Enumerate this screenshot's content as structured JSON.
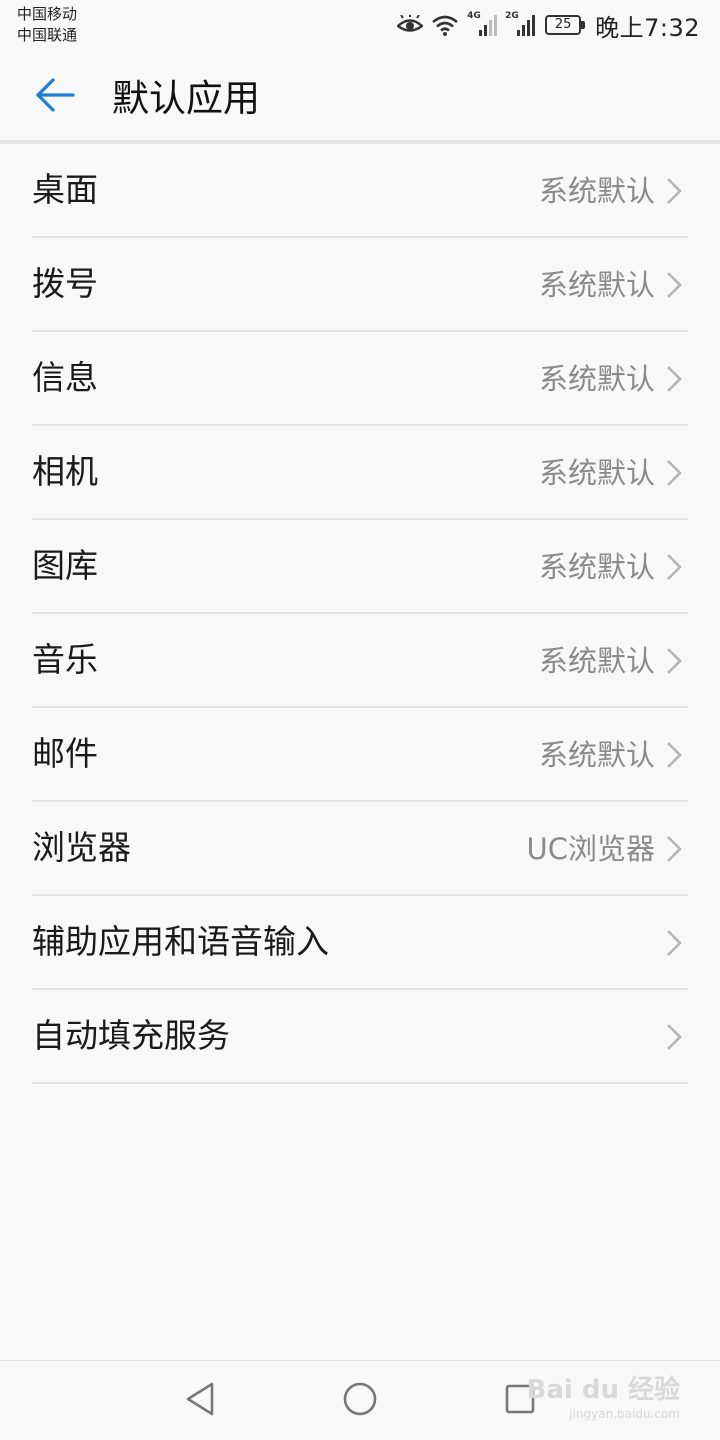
{
  "status_bar": {
    "carrier_1": "中国移动",
    "carrier_2": "中国联通",
    "network_1": "4G",
    "network_2": "2G",
    "battery": "25",
    "time": "晚上7:32",
    "icons": [
      "eye-icon",
      "wifi-icon",
      "signal-icon",
      "signal-icon",
      "battery-icon"
    ]
  },
  "header": {
    "title": "默认应用",
    "back_icon": "arrow-left-icon",
    "accent_color": "#1a7fd4"
  },
  "items": [
    {
      "label": "桌面",
      "value": "系统默认"
    },
    {
      "label": "拨号",
      "value": "系统默认"
    },
    {
      "label": "信息",
      "value": "系统默认"
    },
    {
      "label": "相机",
      "value": "系统默认"
    },
    {
      "label": "图库",
      "value": "系统默认"
    },
    {
      "label": "音乐",
      "value": "系统默认"
    },
    {
      "label": "邮件",
      "value": "系统默认"
    },
    {
      "label": "浏览器",
      "value": "UC浏览器"
    },
    {
      "label": "辅助应用和语音输入",
      "value": ""
    },
    {
      "label": "自动填充服务",
      "value": ""
    }
  ],
  "nav_bar": {
    "back_icon": "triangle-back-icon",
    "home_icon": "circle-home-icon",
    "recents_icon": "square-recents-icon"
  },
  "watermark": {
    "text": "Bai du 经验",
    "sub": "jingyan.baidu.com"
  }
}
